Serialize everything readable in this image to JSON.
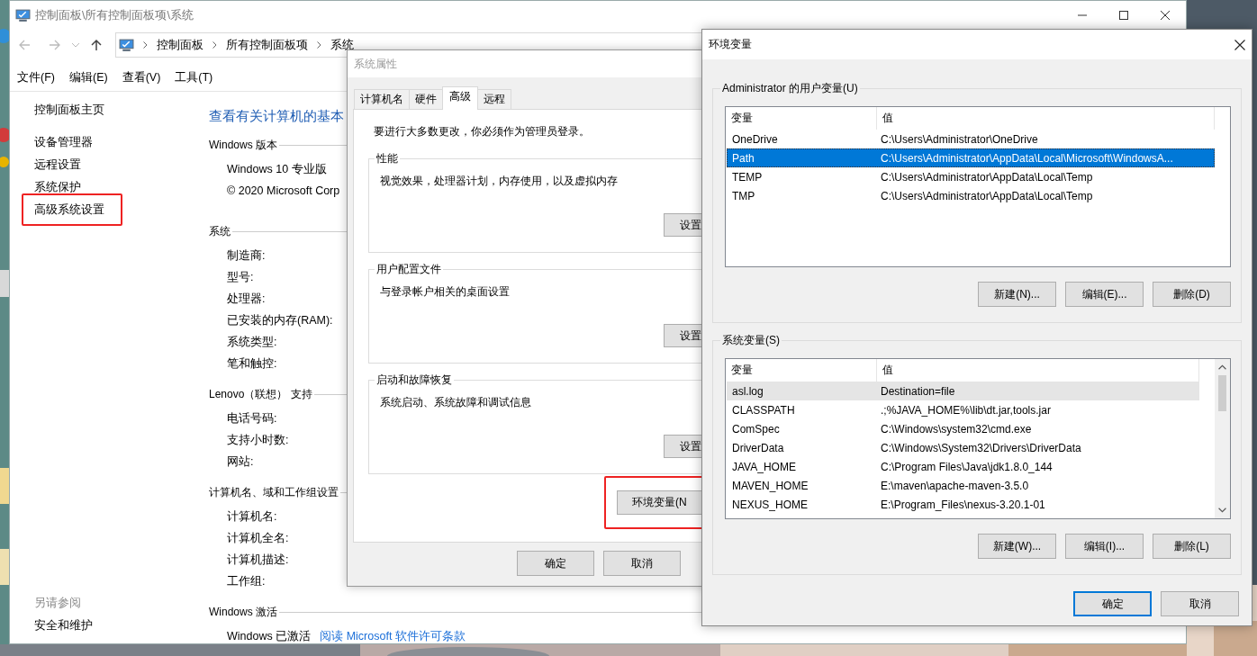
{
  "control_panel": {
    "title": "控制面板\\所有控制面板项\\系统",
    "address": [
      "控制面板",
      "所有控制面板项",
      "系统"
    ],
    "menu": [
      "文件(F)",
      "编辑(E)",
      "查看(V)",
      "工具(T)"
    ],
    "sidebar": {
      "home": "控制面板主页",
      "items": [
        {
          "label": "设备管理器",
          "highlighted": false
        },
        {
          "label": "远程设置",
          "highlighted": false
        },
        {
          "label": "系统保护",
          "highlighted": false
        },
        {
          "label": "高级系统设置",
          "highlighted": true
        }
      ],
      "see_also_heading": "另请参阅",
      "see_also": [
        "安全和维护"
      ]
    },
    "heading": "查看有关计算机的基本",
    "sections": [
      {
        "title": "Windows 版本",
        "rows": [
          {
            "label": "Windows 10 专业版"
          },
          {
            "label": "© 2020 Microsoft Corp"
          }
        ]
      },
      {
        "title": "系统",
        "rows": [
          {
            "label": "制造商:"
          },
          {
            "label": "型号:"
          },
          {
            "label": "处理器:"
          },
          {
            "label": "已安装的内存(RAM):"
          },
          {
            "label": "系统类型:"
          },
          {
            "label": "笔和触控:"
          }
        ]
      },
      {
        "title": "Lenovo（联想） 支持",
        "rows": [
          {
            "label": "电话号码:"
          },
          {
            "label": "支持小时数:"
          },
          {
            "label": "网站:"
          }
        ]
      },
      {
        "title": "计算机名、域和工作组设置",
        "rows": [
          {
            "label": "计算机名:"
          },
          {
            "label": "计算机全名:"
          },
          {
            "label": "计算机描述:"
          },
          {
            "label": "工作组:"
          }
        ]
      },
      {
        "title": "Windows 激活",
        "rows": [
          {
            "label": "Windows 已激活",
            "link": "阅读 Microsoft 软件许可条款"
          }
        ]
      }
    ]
  },
  "system_properties": {
    "title": "系统属性",
    "active": false,
    "tabs": [
      {
        "label": "计算机名",
        "selected": false
      },
      {
        "label": "硬件",
        "selected": false
      },
      {
        "label": "高级",
        "selected": true
      },
      {
        "label": "远程",
        "selected": false
      }
    ],
    "notice": "要进行大多数更改，你必须作为管理员登录。",
    "groups": [
      {
        "title": "性能",
        "description": "视觉效果，处理器计划，内存使用，以及虚拟内存",
        "button": "设置"
      },
      {
        "title": "用户配置文件",
        "description": "与登录帐户相关的桌面设置",
        "button": "设置"
      },
      {
        "title": "启动和故障恢复",
        "description": "系统启动、系统故障和调试信息",
        "button": "设置"
      }
    ],
    "env_button": {
      "label": "环境变量(N",
      "highlighted": true
    },
    "buttons": [
      "确定",
      "取消"
    ]
  },
  "environment_variables": {
    "title": "环境变量",
    "active": true,
    "lists": [
      {
        "title": "Administrator 的用户变量(U)",
        "columns": [
          "变量",
          "值"
        ],
        "scrollable": false,
        "rows": [
          {
            "name": "OneDrive",
            "value": "C:\\Users\\Administrator\\OneDrive",
            "selected": false,
            "hovered": false
          },
          {
            "name": "Path",
            "value": "C:\\Users\\Administrator\\AppData\\Local\\Microsoft\\WindowsA...",
            "selected": true,
            "hovered": false
          },
          {
            "name": "TEMP",
            "value": "C:\\Users\\Administrator\\AppData\\Local\\Temp",
            "selected": false,
            "hovered": false
          },
          {
            "name": "TMP",
            "value": "C:\\Users\\Administrator\\AppData\\Local\\Temp",
            "selected": false,
            "hovered": false
          }
        ],
        "buttons": [
          "新建(N)...",
          "编辑(E)...",
          "删除(D)"
        ]
      },
      {
        "title": "系统变量(S)",
        "columns": [
          "变量",
          "值"
        ],
        "scrollable": true,
        "rows": [
          {
            "name": "asl.log",
            "value": "Destination=file",
            "selected": false,
            "hovered": true
          },
          {
            "name": "CLASSPATH",
            "value": ".;%JAVA_HOME%\\lib\\dt.jar,tools.jar",
            "selected": false,
            "hovered": false
          },
          {
            "name": "ComSpec",
            "value": "C:\\Windows\\system32\\cmd.exe",
            "selected": false,
            "hovered": false
          },
          {
            "name": "DriverData",
            "value": "C:\\Windows\\System32\\Drivers\\DriverData",
            "selected": false,
            "hovered": false
          },
          {
            "name": "JAVA_HOME",
            "value": "C:\\Program Files\\Java\\jdk1.8.0_144",
            "selected": false,
            "hovered": false
          },
          {
            "name": "MAVEN_HOME",
            "value": "E:\\maven\\apache-maven-3.5.0",
            "selected": false,
            "hovered": false
          },
          {
            "name": "NEXUS_HOME",
            "value": "E:\\Program_Files\\nexus-3.20.1-01",
            "selected": false,
            "hovered": false
          }
        ],
        "buttons": [
          "新建(W)...",
          "编辑(I)...",
          "删除(L)"
        ]
      }
    ],
    "buttons": [
      {
        "label": "确定",
        "default": true
      },
      {
        "label": "取消",
        "default": false
      }
    ]
  }
}
